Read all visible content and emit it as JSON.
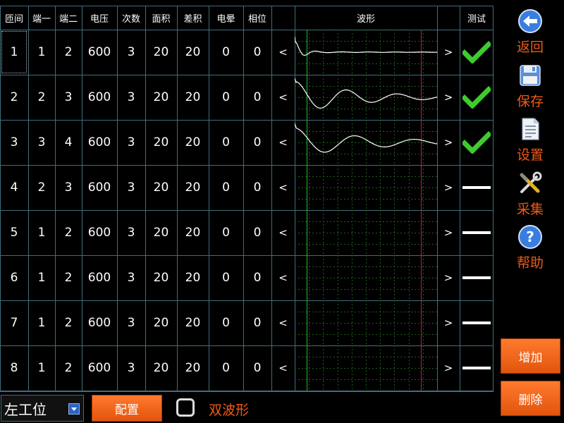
{
  "table": {
    "headers": {
      "idx": "匝间",
      "port1": "端一",
      "port2": "端二",
      "voltage": "电压",
      "count": "次数",
      "area": "面积",
      "diff_area": "差积",
      "corona": "电晕",
      "phase": "相位",
      "waveform": "波形",
      "test": "测试"
    },
    "prev_label": "<",
    "next_label": ">",
    "rows": [
      {
        "idx": "1",
        "port1": "1",
        "port2": "2",
        "voltage": "600",
        "count": "3",
        "area": "20",
        "diff_area": "20",
        "corona": "0",
        "phase": "0",
        "status": "pass",
        "wave": "decay_fast"
      },
      {
        "idx": "2",
        "port1": "2",
        "port2": "3",
        "voltage": "600",
        "count": "3",
        "area": "20",
        "diff_area": "20",
        "corona": "0",
        "phase": "0",
        "status": "pass",
        "wave": "oscillating"
      },
      {
        "idx": "3",
        "port1": "3",
        "port2": "4",
        "voltage": "600",
        "count": "3",
        "area": "20",
        "diff_area": "20",
        "corona": "0",
        "phase": "0",
        "status": "pass",
        "wave": "oscillating_slow"
      },
      {
        "idx": "4",
        "port1": "2",
        "port2": "3",
        "voltage": "600",
        "count": "3",
        "area": "20",
        "diff_area": "20",
        "corona": "0",
        "phase": "0",
        "status": "none",
        "wave": "none"
      },
      {
        "idx": "5",
        "port1": "1",
        "port2": "2",
        "voltage": "600",
        "count": "3",
        "area": "20",
        "diff_area": "20",
        "corona": "0",
        "phase": "0",
        "status": "none",
        "wave": "none"
      },
      {
        "idx": "6",
        "port1": "1",
        "port2": "2",
        "voltage": "600",
        "count": "3",
        "area": "20",
        "diff_area": "20",
        "corona": "0",
        "phase": "0",
        "status": "none",
        "wave": "none"
      },
      {
        "idx": "7",
        "port1": "1",
        "port2": "2",
        "voltage": "600",
        "count": "3",
        "area": "20",
        "diff_area": "20",
        "corona": "0",
        "phase": "0",
        "status": "none",
        "wave": "none"
      },
      {
        "idx": "8",
        "port1": "1",
        "port2": "2",
        "voltage": "600",
        "count": "3",
        "area": "20",
        "diff_area": "20",
        "corona": "0",
        "phase": "0",
        "status": "none",
        "wave": "none"
      }
    ]
  },
  "sidebar": {
    "back_label": "返回",
    "save_label": "保存",
    "settings_label": "设置",
    "collect_label": "采集",
    "help_label": "帮助",
    "add_label": "增加",
    "delete_label": "删除"
  },
  "bottom": {
    "position_value": "左工位",
    "config_label": "配置",
    "dual_wave_label": "双波形",
    "dual_wave_checked": false
  },
  "colors": {
    "grid_line": "#3f6e7c",
    "accent_orange": "#f05a14",
    "pass_green": "#3fcb2e",
    "marker_green": "#1fbf1f",
    "marker_red": "#d02020"
  }
}
